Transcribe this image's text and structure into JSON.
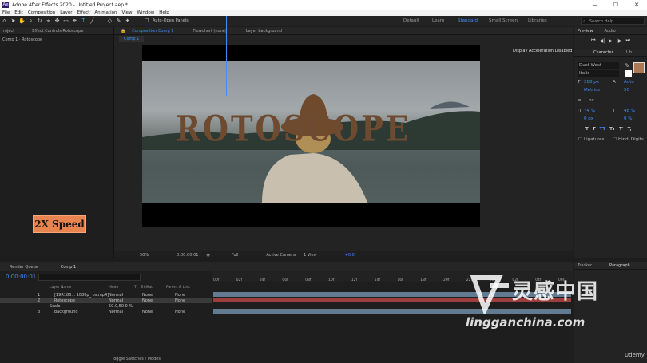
{
  "titlebar": {
    "title": "Adobe After Effects 2020 - Untitled Project.aep *",
    "logo": "Ae",
    "min": "—",
    "max": "☐",
    "close": "✕"
  },
  "menu": [
    "File",
    "Edit",
    "Composition",
    "Layer",
    "Effect",
    "Animation",
    "View",
    "Window",
    "Help"
  ],
  "toolbar": {
    "auto_open": "Auto-Open Panels",
    "workspaces": [
      "Default",
      "Learn",
      "Standard",
      "Small Screen",
      "Libraries"
    ],
    "active_workspace": "Standard",
    "search_placeholder": "Search Help"
  },
  "left_panel": {
    "tabs": [
      "roject",
      "Effect Controls Rotoscope"
    ],
    "subtitle": "Comp 1 · Rotoscope"
  },
  "viewer": {
    "tabs": [
      "Composition Comp 1",
      "Flowchart (none)",
      "Layer background"
    ],
    "comp_tab": "Comp 1",
    "accel_note": "Display Acceleration Disabled",
    "title_overlay": "ROTOSCOPE",
    "controls": {
      "zoom": "50%",
      "time": "0:00:00:01",
      "resolution": "Full",
      "camera": "Active Camera",
      "view": "1 View",
      "exposure": "+0.0"
    }
  },
  "speed_badge": "2X Speed",
  "right_panel": {
    "tabs_top": [
      "Preview",
      "Audio"
    ],
    "tabs_char": [
      "Character",
      "Lib"
    ],
    "font_name": "Dust West",
    "font_style": "Italic",
    "font_size": "288 px",
    "leading": "Auto",
    "kerning": "Metrics",
    "tracking": "50",
    "stroke_unit": "px",
    "vscale": "74 %",
    "hscale": "48 %",
    "baseline": "0 px",
    "tsume": "0 %",
    "styles": [
      "T",
      "T",
      "TT",
      "Tт",
      "T'",
      "T,"
    ],
    "ligatures": "Ligatures",
    "hindi_digits": "Hindi Digits",
    "colors": {
      "fill": "#b07850",
      "stroke": "#ffffff"
    }
  },
  "timeline": {
    "tabs": [
      "Render Queue",
      "Comp 1"
    ],
    "timecode": "0:00:00:01",
    "columns": [
      "Layer Name",
      "Mode",
      "T",
      "TrkMat",
      "Parent & Link"
    ],
    "layers": [
      {
        "num": "1",
        "name": "[19R186... 1080p_ os.mp4]",
        "mode": "Normal",
        "trkmat": "None",
        "parent": "None",
        "color": "#7a9bb8"
      },
      {
        "num": "2",
        "name": "Rotoscope",
        "mode": "Normal",
        "trkmat": "None",
        "parent": "None",
        "color": "#c84a4a"
      },
      {
        "num": "",
        "name": "Scale",
        "mode": "50.0,50.0 %",
        "trkmat": "",
        "parent": "",
        "color": ""
      },
      {
        "num": "3",
        "name": "background",
        "mode": "Normal",
        "trkmat": "None",
        "parent": "None",
        "color": "#7a9bb8"
      }
    ],
    "ruler": [
      "00f",
      "02f",
      "04f",
      "06f",
      "08f",
      "10f",
      "12f",
      "14f",
      "16f",
      "18f",
      "20f",
      "22f",
      "01:00f",
      "02f",
      "04f",
      "06f"
    ],
    "toggle_label": "Toggle Switches / Modes"
  },
  "right_bottom": {
    "tabs": [
      "Tracker",
      "Paragraph"
    ]
  },
  "watermark": {
    "cn": "灵感中国",
    "en": "lingganchina.com"
  },
  "udemy": "Udemy"
}
